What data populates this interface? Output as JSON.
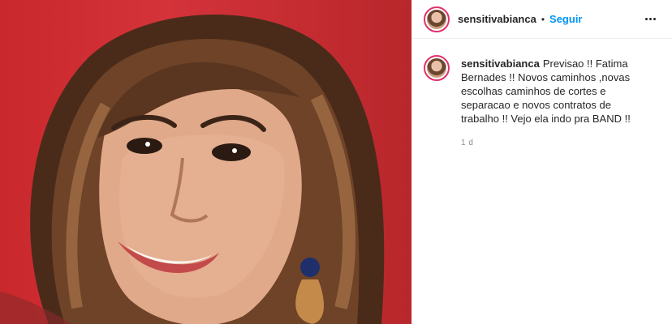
{
  "post": {
    "username": "sensitivabianca",
    "separator": "•",
    "follow_label": "Seguir",
    "caption": "Previsao !! Fatima Bernades !! Novos caminhos ,novas escolhas caminhos de cortes e separacao e novos contratos de trabalho !! Vejo ela indo pra BAND !!",
    "timestamp": "1 d"
  },
  "colors": {
    "accent": "#0095f6",
    "background_red": "#c9282c",
    "story_ring": "#e1306c"
  }
}
